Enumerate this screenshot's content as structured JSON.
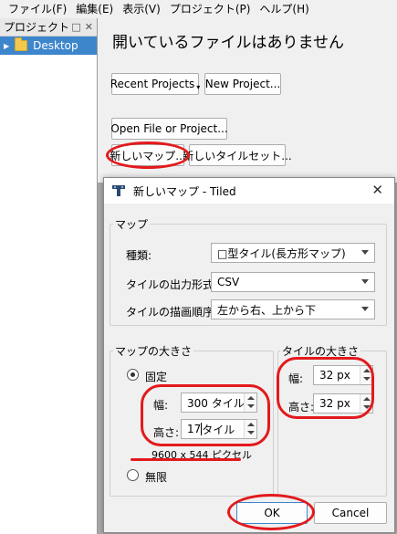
{
  "menu": [
    "ファイル(F)",
    "編集(E)",
    "表示(V)",
    "プロジェクト(P)",
    "ヘルプ(H)"
  ],
  "sidebar": {
    "title": "プロジェクト",
    "controls": [
      "□",
      "✕"
    ],
    "items": [
      {
        "label": "Desktop",
        "selected": true
      }
    ]
  },
  "welcome": {
    "title": "開いているファイルはありません",
    "recent_projects": "Recent Projects",
    "new_project": "New Project...",
    "open_file": "Open File or Project...",
    "new_map": "新しいマップ...",
    "new_tileset": "新しいタイルセット..."
  },
  "dialog": {
    "title": "新しいマップ - Tiled",
    "close": "✕",
    "map_group": {
      "label": "マップ",
      "orientation_label": "種類:",
      "orientation_value": "□型タイル(長方形マップ)",
      "format_label": "タイルの出力形式:",
      "format_value": "CSV",
      "render_order_label": "タイルの描画順序:",
      "render_order_value": "左から右、上から下"
    },
    "size_group": {
      "label": "マップの大きさ",
      "fixed_label": "固定",
      "fixed_checked": true,
      "width_label": "幅:",
      "width_value": "300 タイル",
      "height_label": "高さ:",
      "height_value_pre": "17",
      "height_value_post": "タイル",
      "pixel_size": "9600 x 544 ピクセル",
      "infinite_label": "無限",
      "infinite_checked": false
    },
    "tile_group": {
      "label": "タイルの大きさ",
      "width_label": "幅:",
      "width_value": "32 px",
      "height_label": "高さ:",
      "height_value": "32 px"
    },
    "ok": "OK",
    "cancel": "Cancel"
  },
  "colors": {
    "selection": "#3e86cc",
    "annotation_red": "#e3191c",
    "dialog_bg": "#f0f0f0",
    "backdrop": "#a9a9a9"
  }
}
